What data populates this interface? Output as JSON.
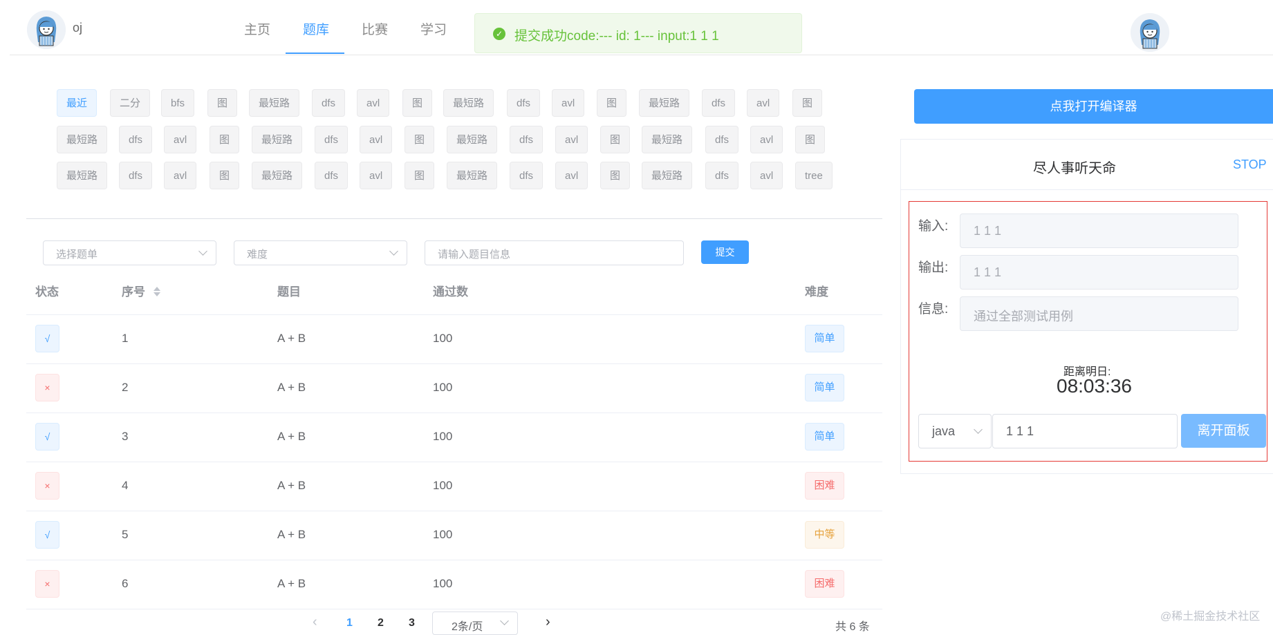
{
  "header": {
    "brand_text": "oj",
    "nav": [
      "主页",
      "题库",
      "比赛",
      "学习"
    ],
    "active_nav": "题库"
  },
  "toast": {
    "message": "提交成功code:--- id: 1--- input:1 1 1"
  },
  "tags": [
    [
      "最近",
      "二分",
      "bfs",
      "图",
      "最短路",
      "dfs",
      "avl",
      "图",
      "最短路",
      "dfs",
      "avl",
      "图",
      "最短路",
      "dfs",
      "avl",
      "图"
    ],
    [
      "最短路",
      "dfs",
      "avl",
      "图",
      "最短路",
      "dfs",
      "avl",
      "图",
      "最短路",
      "dfs",
      "avl",
      "图",
      "最短路",
      "dfs",
      "avl",
      "图"
    ],
    [
      "最短路",
      "dfs",
      "avl",
      "图",
      "最短路",
      "dfs",
      "avl",
      "图",
      "最短路",
      "dfs",
      "avl",
      "图",
      "最短路",
      "dfs",
      "avl",
      "tree"
    ]
  ],
  "filters": {
    "list_placeholder": "选择题单",
    "difficulty_placeholder": "难度",
    "search_placeholder": "请输入题目信息",
    "submit_label": "提交"
  },
  "table": {
    "headers": {
      "status": "状态",
      "id": "序号",
      "title": "题目",
      "passed": "通过数",
      "difficulty": "难度"
    },
    "rows": [
      {
        "status": "√",
        "id": "1",
        "title": "A + B",
        "passed": "100",
        "difficulty": "简单"
      },
      {
        "status": "×",
        "id": "2",
        "title": "A + B",
        "passed": "100",
        "difficulty": "简单"
      },
      {
        "status": "√",
        "id": "3",
        "title": "A + B",
        "passed": "100",
        "difficulty": "简单"
      },
      {
        "status": "×",
        "id": "4",
        "title": "A + B",
        "passed": "100",
        "difficulty": "困难"
      },
      {
        "status": "√",
        "id": "5",
        "title": "A + B",
        "passed": "100",
        "difficulty": "中等"
      },
      {
        "status": "×",
        "id": "6",
        "title": "A + B",
        "passed": "100",
        "difficulty": "困难"
      }
    ]
  },
  "pagination": {
    "prev": "‹",
    "pages": [
      "1",
      "2",
      "3"
    ],
    "page_size": "2条/页",
    "next": "›",
    "total": "共 6 条"
  },
  "compiler": {
    "open_button": "点我打开编译器",
    "motto": "尽人事听天命",
    "stop": "STOP",
    "input_label": "输入:",
    "input_value": "1 1 1",
    "output_label": "输出:",
    "output_value": "1 1 1",
    "info_label": "信息:",
    "info_value": "通过全部测试用例",
    "countdown_label": "距离明日:",
    "countdown": "08:03:36",
    "language": "java",
    "code_input": "1 1 1",
    "leave_button": "离开面板"
  },
  "watermark": "@稀土掘金技术社区",
  "colors": {
    "primary": "#409eff",
    "success": "#67c23a",
    "danger": "#f56c6c",
    "warning": "#e6a23c",
    "highlight_box": "#e53935"
  }
}
